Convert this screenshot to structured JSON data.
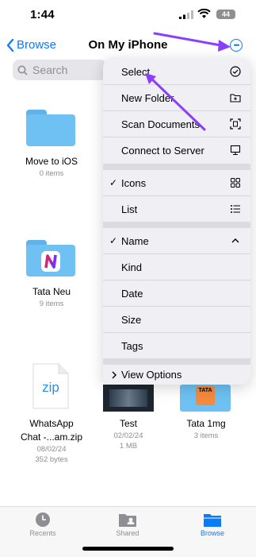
{
  "status": {
    "time": "1:44",
    "battery": "44"
  },
  "nav": {
    "back_label": "Browse",
    "title": "On My iPhone"
  },
  "search": {
    "placeholder": "Search"
  },
  "files": [
    {
      "name": "Move to iOS",
      "meta": "0 items"
    },
    {
      "name": "Tata Neu",
      "meta": "9 items"
    },
    {
      "name_line1": "WhatsApp",
      "name_line2": "Chat -...am.zip",
      "date": "08/02/24",
      "size": "352 bytes",
      "badge": "zip"
    },
    {
      "name": "Test",
      "date": "02/02/24",
      "size": "1 MB"
    },
    {
      "name": "Tata 1mg",
      "meta": "3 items",
      "badge": "TATA"
    }
  ],
  "menu": {
    "items": [
      "Select",
      "New Folder",
      "Scan Documents",
      "Connect to Server"
    ],
    "view": [
      "Icons",
      "List"
    ],
    "sort": [
      "Name",
      "Kind",
      "Date",
      "Size",
      "Tags"
    ],
    "options": "View Options"
  },
  "tabbar": [
    "Recents",
    "Shared",
    "Browse"
  ],
  "colors": {
    "accent": "#0a7aff",
    "annotation": "#8a3ffc"
  }
}
